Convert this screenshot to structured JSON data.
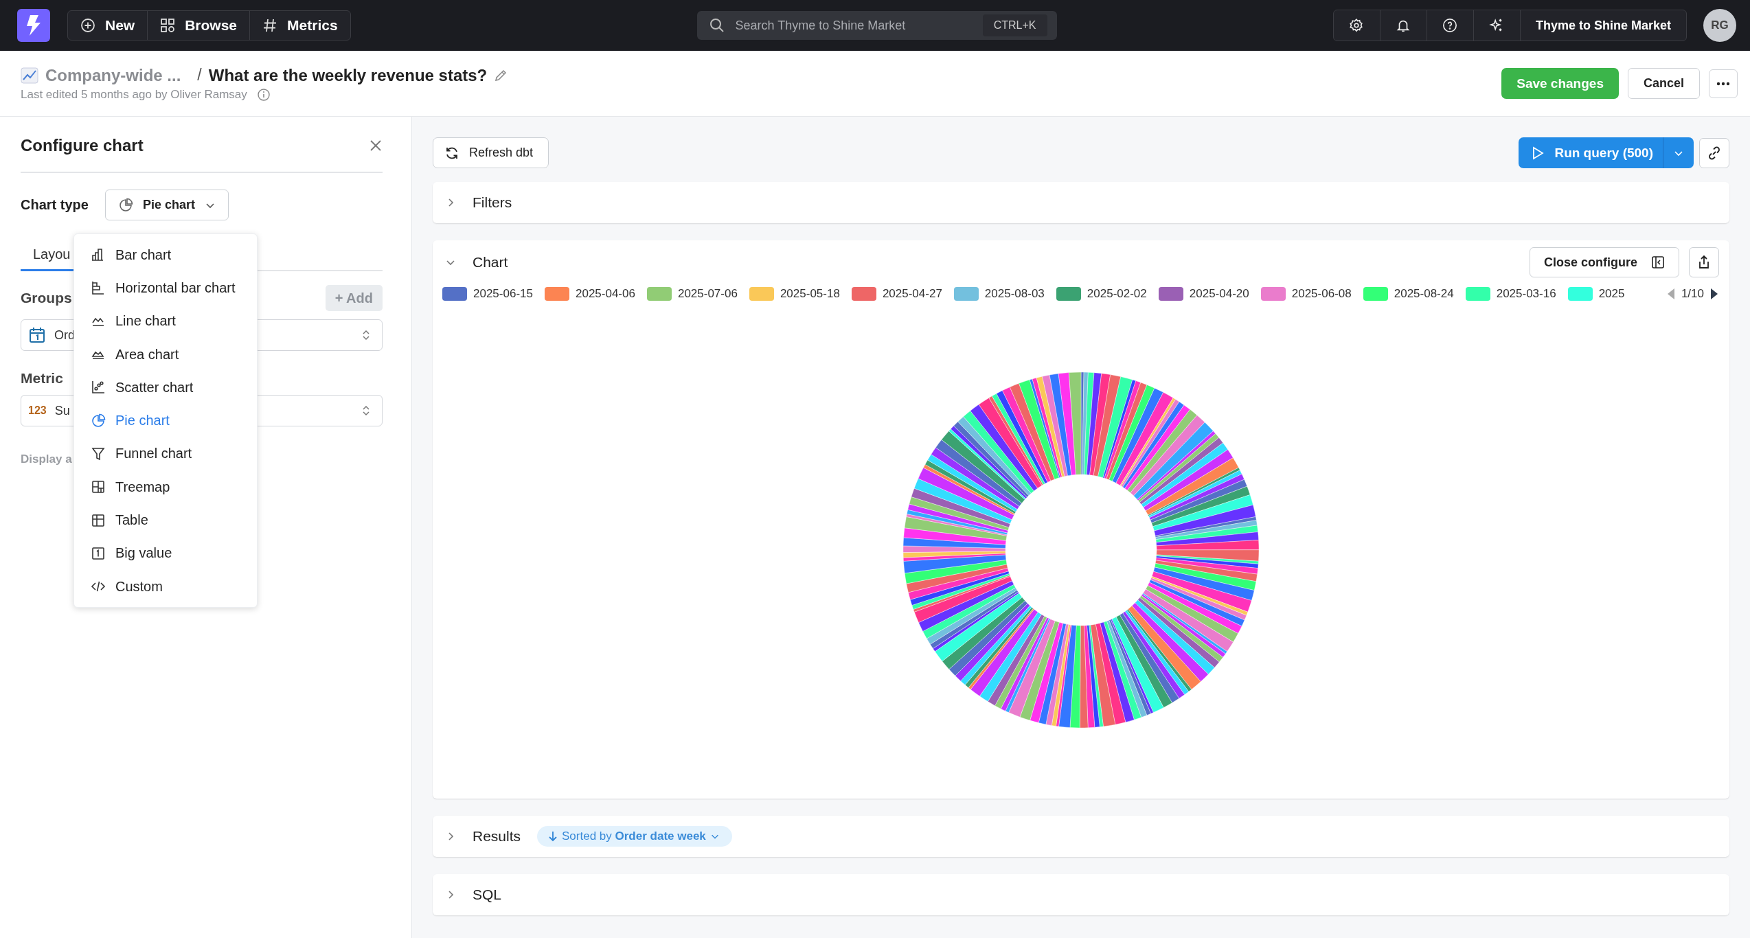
{
  "topbar": {
    "nav": [
      {
        "label": "New",
        "kind": "new"
      },
      {
        "label": "Browse",
        "kind": "browse"
      },
      {
        "label": "Metrics",
        "kind": "metrics"
      }
    ],
    "search": {
      "placeholder": "Search Thyme to Shine Market",
      "shortcut": "CTRL+K"
    },
    "workspace": "Thyme to Shine Market",
    "avatar": "RG"
  },
  "header": {
    "breadcrumb": "Company-wide ...",
    "separator": "/",
    "title": "What are the weekly revenue stats?",
    "meta": "Last edited 5 months ago by Oliver Ramsay",
    "save": "Save changes",
    "cancel": "Cancel"
  },
  "config": {
    "title": "Configure chart",
    "chart_type_label": "Chart type",
    "chart_type_value": "Pie chart",
    "tabs": [
      {
        "label": "Layou",
        "selected": true
      }
    ],
    "groups_label": "Groups",
    "add_button": {
      "label": "+ Add",
      "disabled": true
    },
    "group_value": "Ord",
    "metric_label": "Metric",
    "metric_prefix": "123",
    "metric_value": "Su",
    "display_label": "Display a"
  },
  "chart_type_menu": [
    {
      "label": "Bar chart",
      "kind": "bar",
      "selected": false
    },
    {
      "label": "Horizontal bar chart",
      "kind": "hbar",
      "selected": false
    },
    {
      "label": "Line chart",
      "kind": "line",
      "selected": false
    },
    {
      "label": "Area chart",
      "kind": "area",
      "selected": false
    },
    {
      "label": "Scatter chart",
      "kind": "scatter",
      "selected": false
    },
    {
      "label": "Pie chart",
      "kind": "pie",
      "selected": true
    },
    {
      "label": "Funnel chart",
      "kind": "funnel",
      "selected": false
    },
    {
      "label": "Treemap",
      "kind": "treemap",
      "selected": false
    },
    {
      "label": "Table",
      "kind": "table",
      "selected": false
    },
    {
      "label": "Big value",
      "kind": "bigvalue",
      "selected": false
    },
    {
      "label": "Custom",
      "kind": "custom",
      "selected": false
    }
  ],
  "toolbar": {
    "refresh": "Refresh dbt",
    "run": "Run query (500)"
  },
  "filters": {
    "title": "Filters",
    "expanded": false
  },
  "chart": {
    "title": "Chart",
    "expanded": true,
    "close_configure": "Close configure",
    "legend": [
      {
        "label": "2025-06-15",
        "color": "#5470c6"
      },
      {
        "label": "2025-04-06",
        "color": "#fc8452"
      },
      {
        "label": "2025-07-06",
        "color": "#91cc75"
      },
      {
        "label": "2025-05-18",
        "color": "#fac858"
      },
      {
        "label": "2025-04-27",
        "color": "#ee6666"
      },
      {
        "label": "2025-08-03",
        "color": "#73c0de"
      },
      {
        "label": "2025-02-02",
        "color": "#3ba272"
      },
      {
        "label": "2025-04-20",
        "color": "#9a60b4"
      },
      {
        "label": "2025-06-08",
        "color": "#ea7ccc"
      },
      {
        "label": "2025-08-24",
        "color": "#33ff77"
      },
      {
        "label": "2025-03-16",
        "color": "#33ffaa"
      },
      {
        "label": "2025",
        "color": "#33ffdd"
      }
    ],
    "legend_page": "1/10"
  },
  "results": {
    "title": "Results",
    "expanded": false,
    "sort": "Sorted by **Order date week**"
  },
  "sql": {
    "title": "SQL",
    "expanded": false
  }
}
